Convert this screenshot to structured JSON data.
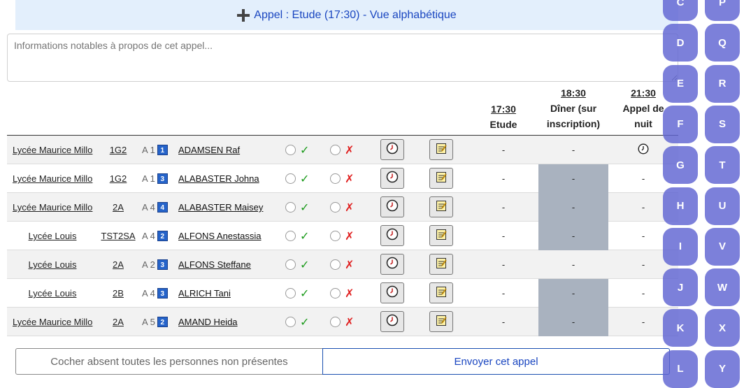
{
  "header": {
    "title": "Appel : Etude (17:30) - Vue alphabétique"
  },
  "notes": {
    "placeholder": "Informations notables à propos de cet appel..."
  },
  "columns": [
    {
      "time": "17:30",
      "label": "Etude"
    },
    {
      "time": "18:30",
      "label": "Dîner (sur inscription)"
    },
    {
      "time": "21:30",
      "label": "Appel de nuit"
    }
  ],
  "rows": [
    {
      "school": "Lycée Maurice Millo",
      "class": "1G2",
      "room": "A 1",
      "badge": "1",
      "name": "ADAMSEN Raf",
      "v1": "-",
      "v2": "-",
      "v2_grey": false,
      "v3_icon": "clock-icon"
    },
    {
      "school": "Lycée Maurice Millo",
      "class": "1G2",
      "room": "A 1",
      "badge": "3",
      "name": "ALABASTER Johna",
      "v1": "-",
      "v2": "-",
      "v2_grey": true,
      "v3": "-"
    },
    {
      "school": "Lycée Maurice Millo",
      "class": "2A",
      "room": "A 4",
      "badge": "4",
      "name": "ALABASTER Maisey",
      "v1": "-",
      "v2": "-",
      "v2_grey": true,
      "v3": "-"
    },
    {
      "school": "Lycée Louis",
      "class": "TST2SA",
      "room": "A 4",
      "badge": "2",
      "name": "ALFONS Anestassia",
      "v1": "-",
      "v2": "-",
      "v2_grey": true,
      "v3": "-"
    },
    {
      "school": "Lycée Louis",
      "class": "2A",
      "room": "A 2",
      "badge": "3",
      "name": "ALFONS Steffane",
      "v1": "-",
      "v2": "-",
      "v2_grey": false,
      "v3": "-"
    },
    {
      "school": "Lycée Louis",
      "class": "2B",
      "room": "A 4",
      "badge": "3",
      "name": "ALRICH Tani",
      "v1": "-",
      "v2": "-",
      "v2_grey": true,
      "v3": "-"
    },
    {
      "school": "Lycée Maurice Millo",
      "class": "2A",
      "room": "A 5",
      "badge": "2",
      "name": "AMAND Heida",
      "v1": "-",
      "v2": "-",
      "v2_grey": true,
      "v3": "-"
    }
  ],
  "symbols": {
    "present": "✓",
    "absent": "✗"
  },
  "actions": {
    "mark_absent": "Cocher absent toutes les personnes non présentes",
    "send": "Envoyer cet appel"
  },
  "alphabet_left": [
    "C",
    "D",
    "E",
    "F",
    "G",
    "H",
    "I",
    "J",
    "K",
    "L"
  ],
  "alphabet_right": [
    "P",
    "Q",
    "R",
    "S",
    "T",
    "U",
    "V",
    "W",
    "X",
    "Y"
  ],
  "colors": {
    "accent": "#1a46c0",
    "header_bg": "#e3effc",
    "letter_bg": "#6368d4",
    "grey_cell": "#a9b2bf"
  }
}
